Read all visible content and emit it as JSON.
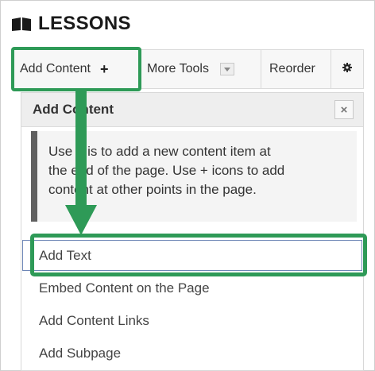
{
  "header": {
    "title": "LESSONS",
    "icon": "book-icon"
  },
  "toolbar": {
    "add_content_label": "Add Content",
    "add_content_icon": "plus-icon",
    "more_tools_label": "More Tools",
    "reorder_label": "Reorder",
    "settings_icon": "gear-icon"
  },
  "panel": {
    "title": "Add Content",
    "close_icon": "close-icon",
    "info_lines": [
      "Use this to add a new content item at",
      "the end of the page. Use + icons to add",
      "content at other points in the page."
    ],
    "items": [
      {
        "label": "Add Text"
      },
      {
        "label": "Embed Content on the Page"
      },
      {
        "label": "Add Content Links"
      },
      {
        "label": "Add Subpage"
      }
    ]
  },
  "colors": {
    "highlight": "#2e9a57",
    "toolbar_bg": "#f7f7f7",
    "panel_head_bg": "#eeeeee",
    "info_border": "#606060"
  }
}
